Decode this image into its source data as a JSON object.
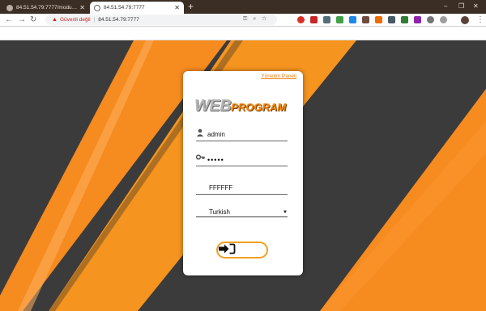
{
  "browser": {
    "tabs": [
      {
        "title": "84.51.54.79:7777/modulsecim.a",
        "active": false
      },
      {
        "title": "84.51.54.79:7777",
        "active": true
      }
    ],
    "new_tab_symbol": "+",
    "window_controls": [
      "–",
      "❐",
      "✕"
    ],
    "security_label": "Güvenli değil",
    "url": "84.51.54.79:7777"
  },
  "login": {
    "panel_link": "Yönetim Paneli",
    "logo_web": "WEB",
    "logo_program": "PROGRAM",
    "username": "admin",
    "password_mask": "•••••",
    "code": "FFFFFF",
    "language": "Turkish"
  },
  "colors": {
    "accent": "#f28a12",
    "dark_bg": "#3b3b3b",
    "button_border": "#f0a020"
  }
}
